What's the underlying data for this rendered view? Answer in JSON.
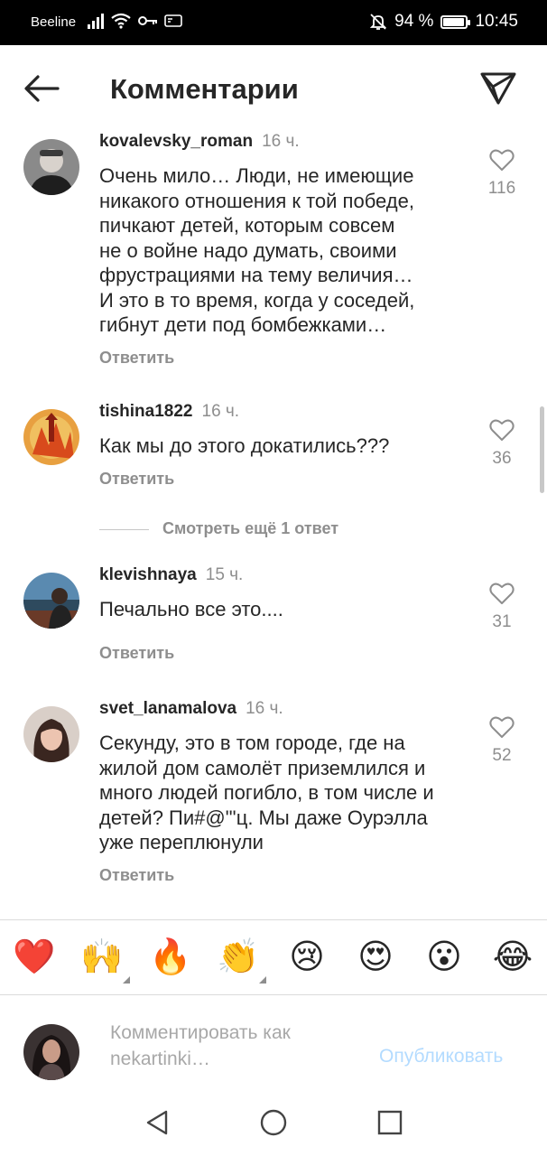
{
  "status_bar": {
    "carrier": "Beeline",
    "battery_text": "94 %",
    "battery_level": 0.94,
    "time": "10:45"
  },
  "header": {
    "title": "Комментарии",
    "back_icon": "arrow-left-icon",
    "send_icon": "paper-plane-icon"
  },
  "comments": [
    {
      "username": "kovalevsky_roman",
      "time": "16 ч.",
      "lines": [
        "Очень мило… Люди, не имеющие",
        "никакого отношения к той победе,",
        "пичкают детей, которым совсем",
        "не о войне надо думать, своими",
        "фрустрациями на тему величия…",
        "И это в то время, когда у соседей,",
        "гибнут дети под бомбежками…"
      ],
      "reply_label": "Ответить",
      "likes": "116"
    },
    {
      "username": "tishina1822",
      "time": "16 ч.",
      "lines": [
        "Как мы до этого докатились???"
      ],
      "reply_label": "Ответить",
      "likes": "36"
    },
    {
      "username": "klevishnaya",
      "time": "15 ч.",
      "lines": [
        "Печально все это...."
      ],
      "reply_label": "Ответить",
      "likes": "31"
    },
    {
      "username": "svet_lanamalova",
      "time": "16 ч.",
      "lines": [
        "Секунду, это в том городе, где на",
        "жилой дом самолёт приземлился и",
        "много людей погибло, в том числе и",
        "детей? Пи#@\"'ц. Мы даже Оурэлла",
        "уже переплюнули"
      ],
      "reply_label": "Ответить",
      "likes": "52"
    }
  ],
  "more_replies": "Смотреть ещё 1 ответ",
  "emojis": [
    "❤️",
    "🙌",
    "🔥",
    "👏",
    "😢",
    "😍",
    "😮",
    "😂"
  ],
  "composer": {
    "placeholder_line1": "Комментировать как",
    "placeholder_line2": "nekartinki…",
    "publish_label": "Опубликовать"
  },
  "colors": {
    "text": "#262626",
    "secondary": "#8e8e8e",
    "publish_disabled": "#b3dbff"
  }
}
